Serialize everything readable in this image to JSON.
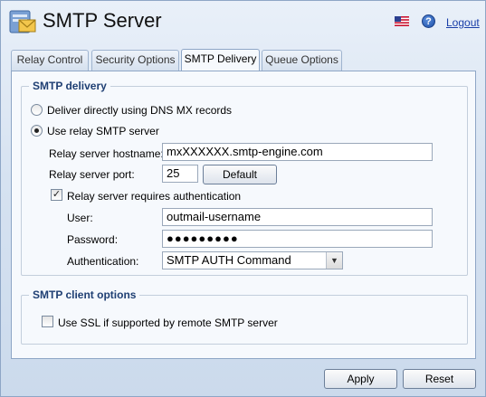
{
  "header": {
    "title": "SMTP Server",
    "logout_label": "Logout",
    "flag_icon": "us-flag-icon",
    "help_icon": "help-icon",
    "help_glyph": "?"
  },
  "tabs": [
    {
      "label": "Relay Control",
      "active": false
    },
    {
      "label": "Security Options",
      "active": false
    },
    {
      "label": "SMTP Delivery",
      "active": true
    },
    {
      "label": "Queue Options",
      "active": false
    }
  ],
  "smtp_delivery": {
    "legend": "SMTP delivery",
    "option_direct": {
      "label": "Deliver directly using DNS MX records",
      "checked": false
    },
    "option_relay": {
      "label": "Use relay SMTP server",
      "checked": true
    },
    "hostname": {
      "label": "Relay server hostname:",
      "value": "mxXXXXXX.smtp-engine.com"
    },
    "port": {
      "label": "Relay server port:",
      "value": "25"
    },
    "default_button": "Default",
    "auth_required": {
      "label": "Relay server requires authentication",
      "checked": true,
      "mark": "✓"
    },
    "user": {
      "label": "User:",
      "value": "outmail-username"
    },
    "password": {
      "label": "Password:",
      "value": "●●●●●●●●●"
    },
    "authentication": {
      "label": "Authentication:",
      "value": "SMTP AUTH Command"
    }
  },
  "client_options": {
    "legend": "SMTP client options",
    "use_ssl": {
      "label": "Use SSL if supported by remote SMTP server",
      "checked": false
    }
  },
  "footer": {
    "apply_label": "Apply",
    "reset_label": "Reset"
  },
  "colors": {
    "accent": "#1f3f73",
    "link": "#1a3ea8",
    "window_bg": "#d6e2f1"
  }
}
